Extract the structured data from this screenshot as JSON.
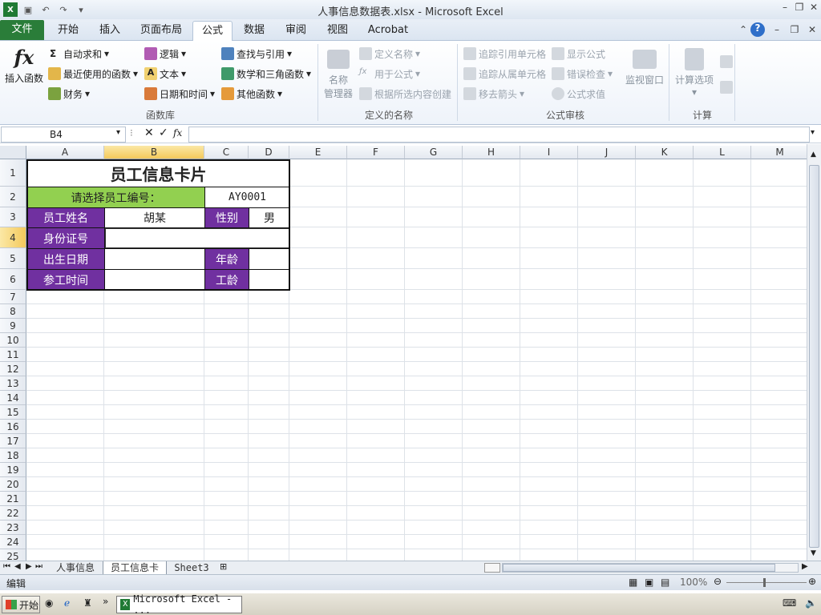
{
  "window": {
    "title": "人事信息数据表.xlsx - Microsoft Excel"
  },
  "tabs": [
    "文件",
    "开始",
    "插入",
    "页面布局",
    "公式",
    "数据",
    "审阅",
    "视图",
    "Acrobat"
  ],
  "ribbon": {
    "insert_function": "插入函数",
    "autosum": "自动求和",
    "recent": "最近使用的函数",
    "finance": "财务",
    "logic": "逻辑",
    "text": "文本",
    "datetime": "日期和时间",
    "lookup": "查找与引用",
    "math": "数学和三角函数",
    "other": "其他函数",
    "group_library": "函数库",
    "name_mgr_1": "名称",
    "name_mgr_2": "管理器",
    "define_name": "定义名称",
    "use_in_formula": "用于公式",
    "create_from_sel": "根据所选内容创建",
    "group_names": "定义的名称",
    "trace_prec": "追踪引用单元格",
    "trace_dep": "追踪从属单元格",
    "remove_arrows": "移去箭头",
    "show_formulas": "显示公式",
    "error_check": "错误检查",
    "eval_formula": "公式求值",
    "watch": "监视窗口",
    "group_audit": "公式审核",
    "calc_options": "计算选项",
    "group_calc": "计算"
  },
  "formula_bar": {
    "name_box": "B4",
    "value": ""
  },
  "columns": [
    "A",
    "B",
    "C",
    "D",
    "E",
    "F",
    "G",
    "H",
    "I",
    "J",
    "K",
    "L",
    "M"
  ],
  "rows": [
    "1",
    "2",
    "3",
    "4",
    "5",
    "6",
    "7",
    "8",
    "9",
    "10",
    "11",
    "12",
    "13",
    "14",
    "15",
    "16",
    "17",
    "18",
    "19",
    "20",
    "21",
    "22",
    "23",
    "24",
    "25"
  ],
  "card": {
    "title": "员工信息卡片",
    "select_label": "请选择员工编号：",
    "employee_id": "AY0001",
    "name_label": "员工姓名",
    "name_value": "胡某",
    "gender_label": "性别",
    "gender_value": "男",
    "id_label": "身份证号",
    "birth_label": "出生日期",
    "age_label": "年龄",
    "work_label": "参工时间",
    "seniority_label": "工龄"
  },
  "sheets": [
    "人事信息",
    "员工信息卡",
    "Sheet3"
  ],
  "status": {
    "mode": "编辑",
    "zoom": "100%"
  },
  "taskbar": {
    "start": "开始",
    "item": "Microsoft Excel - ..."
  },
  "colors": {
    "purple": "#7030a0",
    "green": "#92d050",
    "file_tab": "#2a7d39"
  }
}
